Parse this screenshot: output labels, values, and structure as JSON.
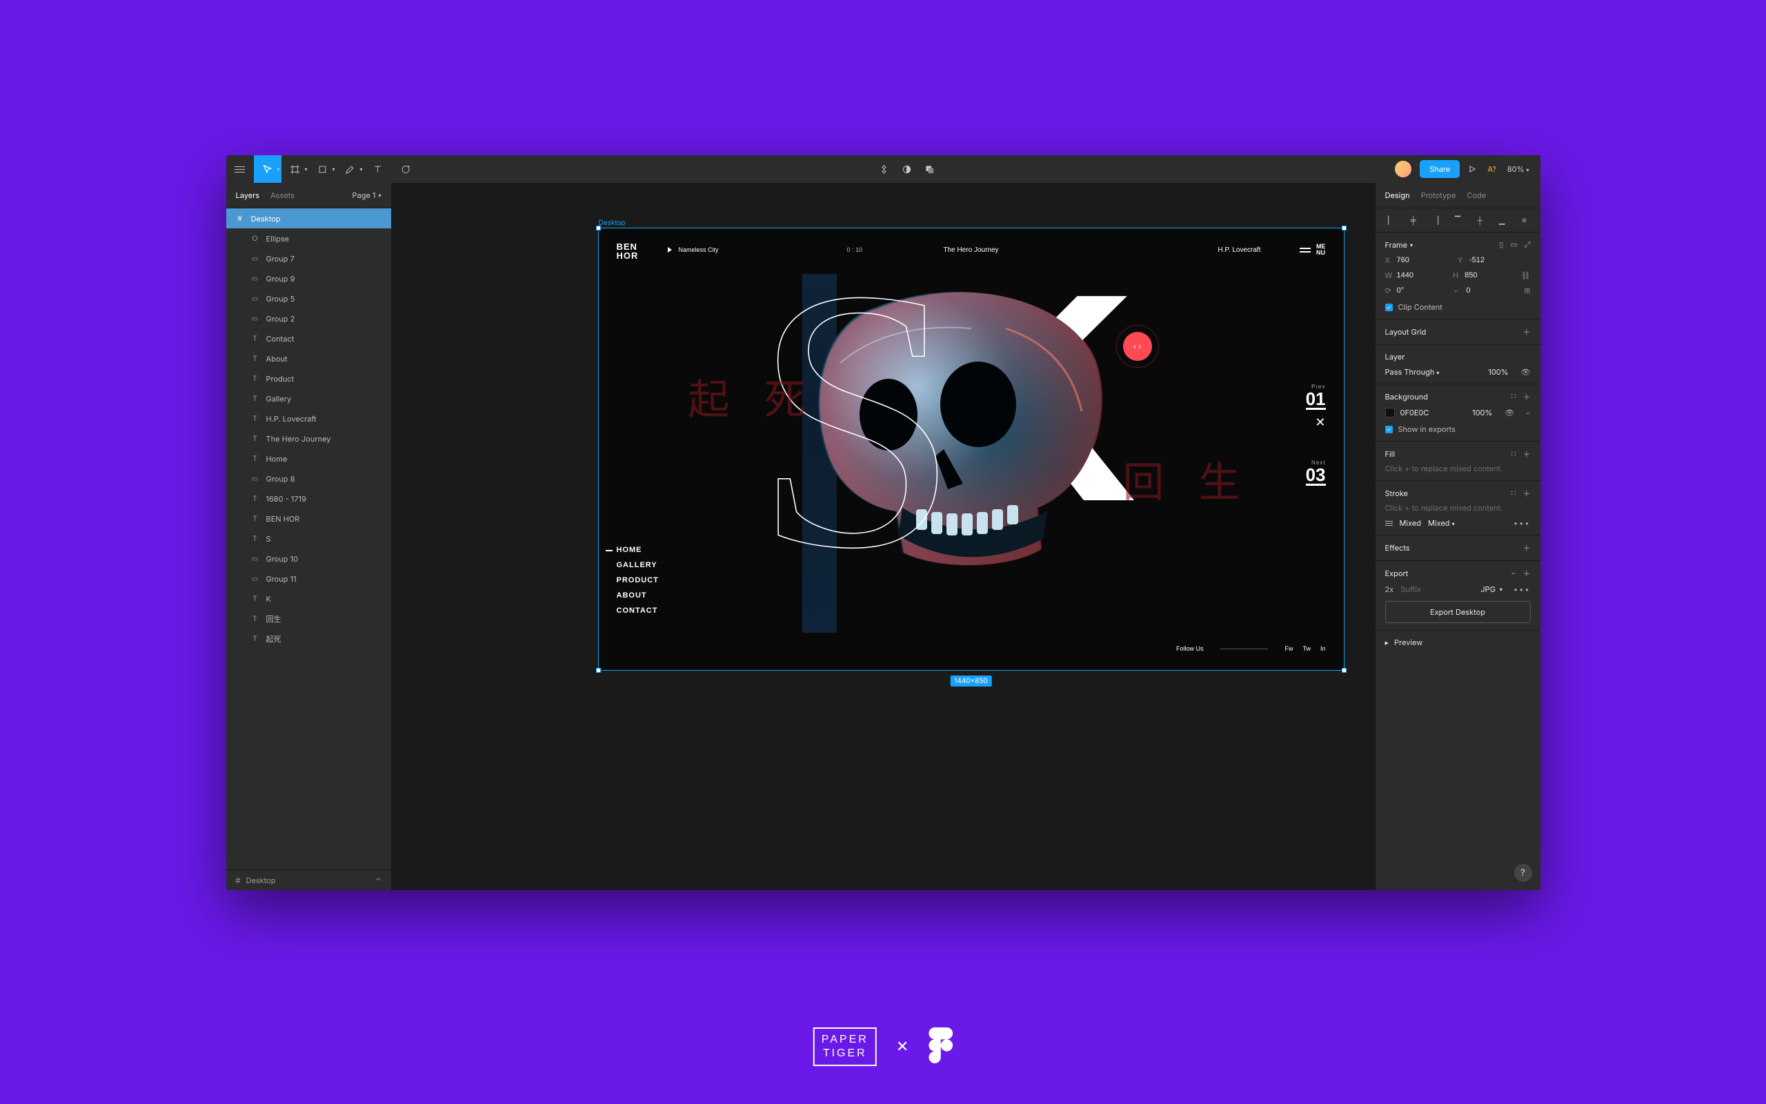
{
  "toolbar": {
    "share_label": "Share",
    "missing_font": "A?",
    "zoom": "80%"
  },
  "left": {
    "tab_layers": "Layers",
    "tab_assets": "Assets",
    "page_selector": "Page 1",
    "bottom_frame": "Desktop",
    "layers": [
      {
        "icon": "frame",
        "label": "Desktop",
        "selected": true,
        "child": false
      },
      {
        "icon": "ellipse",
        "label": "Ellipse",
        "child": true
      },
      {
        "icon": "group",
        "label": "Group 7",
        "child": true
      },
      {
        "icon": "group",
        "label": "Group 9",
        "child": true
      },
      {
        "icon": "group",
        "label": "Group 5",
        "child": true
      },
      {
        "icon": "group",
        "label": "Group 2",
        "child": true
      },
      {
        "icon": "text",
        "label": "Contact",
        "child": true
      },
      {
        "icon": "text",
        "label": "About",
        "child": true
      },
      {
        "icon": "text",
        "label": "Product",
        "child": true
      },
      {
        "icon": "text",
        "label": "Gallery",
        "child": true
      },
      {
        "icon": "text",
        "label": "H.P. Lovecraft",
        "child": true
      },
      {
        "icon": "text",
        "label": "The Hero Journey",
        "child": true
      },
      {
        "icon": "text",
        "label": "Home",
        "child": true
      },
      {
        "icon": "group",
        "label": "Group 8",
        "child": true
      },
      {
        "icon": "text",
        "label": "1680 - 1719",
        "child": true
      },
      {
        "icon": "text",
        "label": "BEN HOR",
        "child": true
      },
      {
        "icon": "text",
        "label": "S",
        "child": true
      },
      {
        "icon": "group",
        "label": "Group 10",
        "child": true
      },
      {
        "icon": "group",
        "label": "Group 11",
        "child": true
      },
      {
        "icon": "text",
        "label": "K",
        "child": true
      },
      {
        "icon": "text",
        "label": "回生",
        "child": true
      },
      {
        "icon": "text",
        "label": "起死",
        "child": true
      }
    ]
  },
  "canvas": {
    "frame_label": "Desktop",
    "dimensions": "1440×850",
    "logo_l1": "BEN",
    "logo_l2": "HOR",
    "track": "Nameless City",
    "duration": "0 : 10",
    "center_top": "The Hero Journey",
    "right_top": "H.P. Lovecraft",
    "menu_l1": "ME",
    "menu_l2": "NU",
    "kanji1": "起",
    "kanji2": "死",
    "kanji3": "回",
    "kanji4": "生",
    "bigS": "S",
    "bigK": "K",
    "disc": "‹ ›",
    "prev_lbl": "Prev",
    "prev_num": "01",
    "next_lbl": "Next",
    "next_num": "03",
    "nav": [
      "HOME",
      "GALLERY",
      "PRODUCT",
      "ABOUT",
      "CONTACT"
    ],
    "follow": "Follow Us",
    "s1": "Fw",
    "s2": "Tw",
    "s3": "In"
  },
  "right": {
    "tab_design": "Design",
    "tab_prototype": "Prototype",
    "tab_code": "Code",
    "frame_title": "Frame",
    "x": "760",
    "y": "-512",
    "w": "1440",
    "h": "850",
    "rot": "0°",
    "rad": "0",
    "clip_label": "Clip Content",
    "layoutgrid": "Layout Grid",
    "layer_title": "Layer",
    "blend": "Pass Through",
    "opacity": "100%",
    "bg_title": "Background",
    "bg_hex": "0F0E0C",
    "bg_pct": "100%",
    "show_exports": "Show in exports",
    "fill_title": "Fill",
    "fill_hint": "Click + to replace mixed content.",
    "stroke_title": "Stroke",
    "stroke_hint": "Click + to replace mixed content.",
    "stroke_mix1": "Mixed",
    "stroke_mix2": "Mixed",
    "effects_title": "Effects",
    "export_title": "Export",
    "export_scale": "2x",
    "export_suffix": "Suffix",
    "export_fmt": "JPG",
    "export_btn": "Export Desktop",
    "preview": "Preview"
  },
  "branding": {
    "l1": "PAPER",
    "l2": "TIGER",
    "x": "✕"
  }
}
